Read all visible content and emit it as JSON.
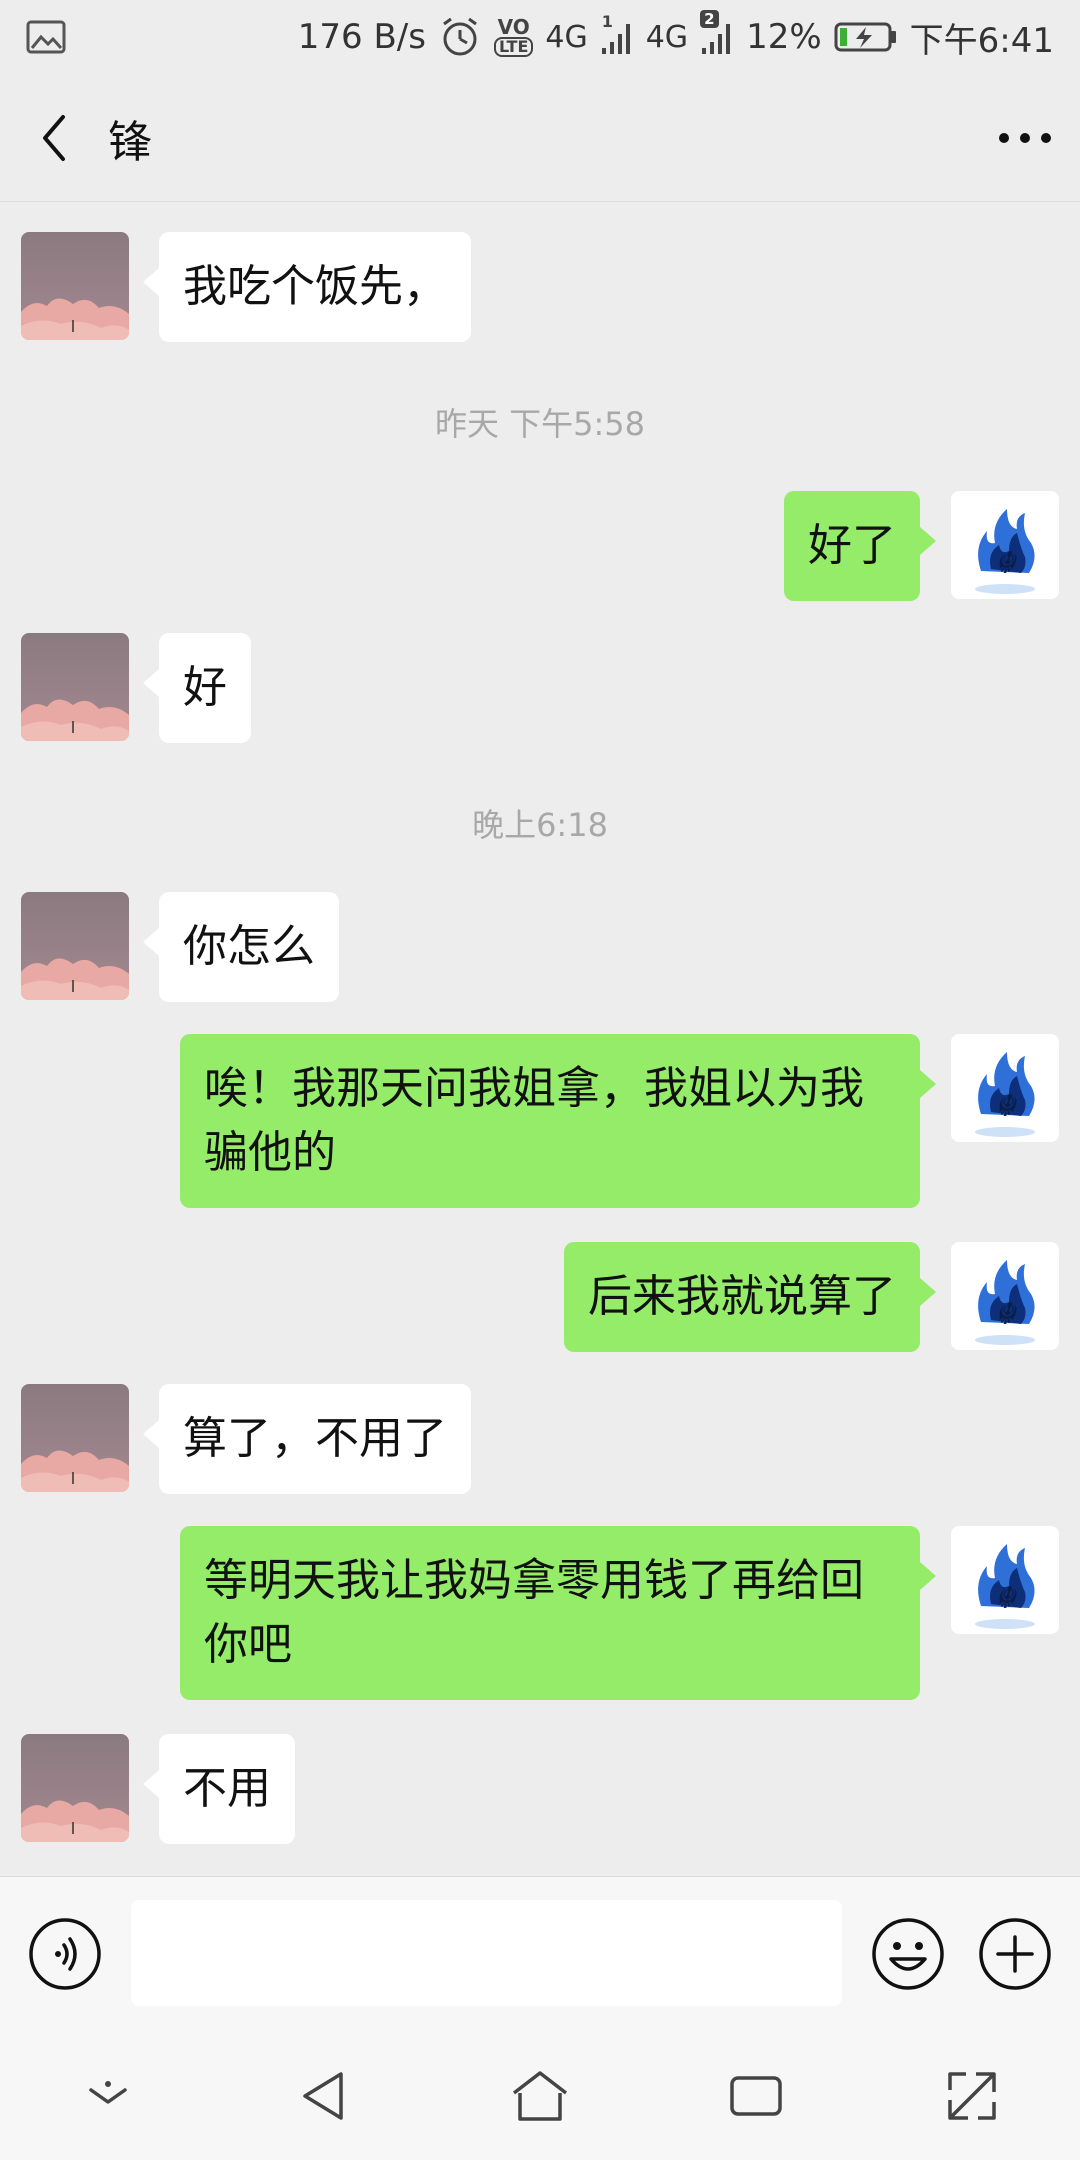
{
  "status_bar": {
    "net_speed": "176 B/s",
    "sim1_type": "4G",
    "sim1_index": "1",
    "sim2_type": "4G",
    "sim2_index": "2",
    "volte": "VO",
    "lte": "LTE",
    "battery": "12%",
    "time": "下午6:41"
  },
  "header": {
    "title": "锋"
  },
  "messages": [
    {
      "type": "text",
      "side": "peer",
      "text": "我吃个饭先，"
    },
    {
      "type": "time",
      "text": "昨天 下午5:58"
    },
    {
      "type": "text",
      "side": "self",
      "text": "好了"
    },
    {
      "type": "text",
      "side": "peer",
      "text": "好"
    },
    {
      "type": "time",
      "text": "晚上6:18"
    },
    {
      "type": "text",
      "side": "peer",
      "text": "你怎么"
    },
    {
      "type": "text",
      "side": "self",
      "line1": "唉！我那天问我姐拿，我姐以为我",
      "line2": "骗他的"
    },
    {
      "type": "text",
      "side": "self",
      "text": "后来我就说算了"
    },
    {
      "type": "text",
      "side": "peer",
      "text": "算了，不用了"
    },
    {
      "type": "text",
      "side": "self",
      "line1": "等明天我让我妈拿零用钱了再给回",
      "line2": "你吧"
    },
    {
      "type": "text",
      "side": "peer",
      "text": "不用"
    }
  ],
  "input": {
    "value": ""
  },
  "avatar_colors": {
    "peer_sky": "#8a7a80",
    "peer_cloud": "#e8a9a4",
    "self_flame": "#2e6fd8"
  },
  "accent": {
    "self_bubble": "#95ec69",
    "peer_bubble": "#ffffff",
    "background": "#ededed"
  }
}
